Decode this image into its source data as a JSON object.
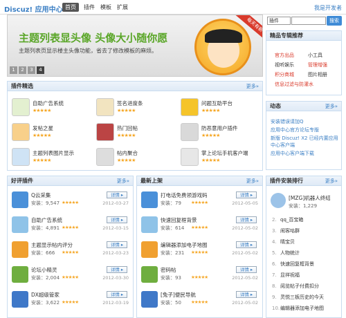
{
  "header": {
    "logo": "Discuz! 应用中心",
    "nav": [
      "首页",
      "插件",
      "模板",
      "扩展"
    ],
    "dev": "我是开发者"
  },
  "banner": {
    "title": "主题列表显头像  头像大小随你愿",
    "subtitle": "主题列表页显示楼主头像功能，省去了修改模板的麻烦。",
    "ribbon": "每天有新",
    "pages": [
      "1",
      "2",
      "3",
      "4"
    ]
  },
  "search": {
    "select": "插件",
    "button": "搜索"
  },
  "topics": {
    "title": "精品专辑推荐",
    "items": [
      [
        "官方出品",
        "小工具"
      ],
      [
        "视听娱乐",
        "管理增强"
      ],
      [
        "积分商城",
        "图片相册"
      ],
      [
        "信息过滤与防灌水",
        ""
      ]
    ]
  },
  "picks": {
    "title": "插件精选",
    "more": "更多»",
    "items": [
      {
        "name": "自助广告系统",
        "icon": "ad-icon"
      },
      {
        "name": "签名进度条",
        "icon": "signature-icon"
      },
      {
        "name": "问题互助平台",
        "icon": "question-icon"
      },
      {
        "name": "发帖之星",
        "icon": "star-icon"
      },
      {
        "name": "热门回帖",
        "icon": "hot-reply-icon"
      },
      {
        "name": "防恶意用户插件",
        "icon": "guard-icon"
      },
      {
        "name": "主题列表图片显示",
        "icon": "picture-icon"
      },
      {
        "name": "帖内聚合",
        "icon": "aggregate-icon"
      },
      {
        "name": "掌上论坛手机客户端",
        "icon": "mobile-icon"
      }
    ],
    "stars": "★★★★★"
  },
  "dynamic": {
    "title": "动态",
    "more": "更多»",
    "items": [
      "安装错误请加Q",
      "应用中心官方论坛专版",
      "新版 Discuz! X2 已经内置应用中心客户端",
      "应用中心客户端下载"
    ]
  },
  "good": {
    "title": "好评插件",
    "more": "更多»",
    "items": [
      {
        "name": "Q云采集",
        "installs": "安装：9,547",
        "date": "2012-03-27"
      },
      {
        "name": "自助广告系统",
        "installs": "安装：4,891",
        "date": "2012-03-15"
      },
      {
        "name": "主题显示帖内评分",
        "installs": "安装：666",
        "date": "2012-03-23"
      },
      {
        "name": "论坛小精灵",
        "installs": "安装：2,004",
        "date": "2012-03-30"
      },
      {
        "name": "DX超级管家",
        "installs": "安装：3,622",
        "date": "2012-03-19"
      }
    ]
  },
  "new": {
    "title": "最新上架",
    "more": "更多»",
    "items": [
      {
        "name": "打电话免费领游戏码",
        "installs": "安装：79",
        "date": "2012-05-05"
      },
      {
        "name": "快速回复框背景",
        "installs": "安装：614",
        "date": "2012-05-02"
      },
      {
        "name": "编辑器添加电子地图",
        "installs": "安装：231",
        "date": "2012-05-02"
      },
      {
        "name": "密码帖",
        "installs": "安装：93",
        "date": "2012-05-02"
      },
      {
        "name": "[兔子]便民导航",
        "installs": "安装：50",
        "date": "2012-05-02"
      }
    ]
  },
  "rank": {
    "title": "插件安装排行",
    "more": "更多»",
    "top": {
      "name": "[MZG]机器人终结",
      "installs": "安装：1,229"
    },
    "items": [
      "qq_百宝箱",
      "闹客咕群",
      "晴宝贝",
      "人物统计",
      "快速回复框背景",
      "显祥祝福",
      "阅览帖子付费扣分",
      "灵悦三板历史的今天",
      "编辑器添加电子地图"
    ]
  },
  "detail_label": "详情 ▸",
  "stars": "★★★★★"
}
